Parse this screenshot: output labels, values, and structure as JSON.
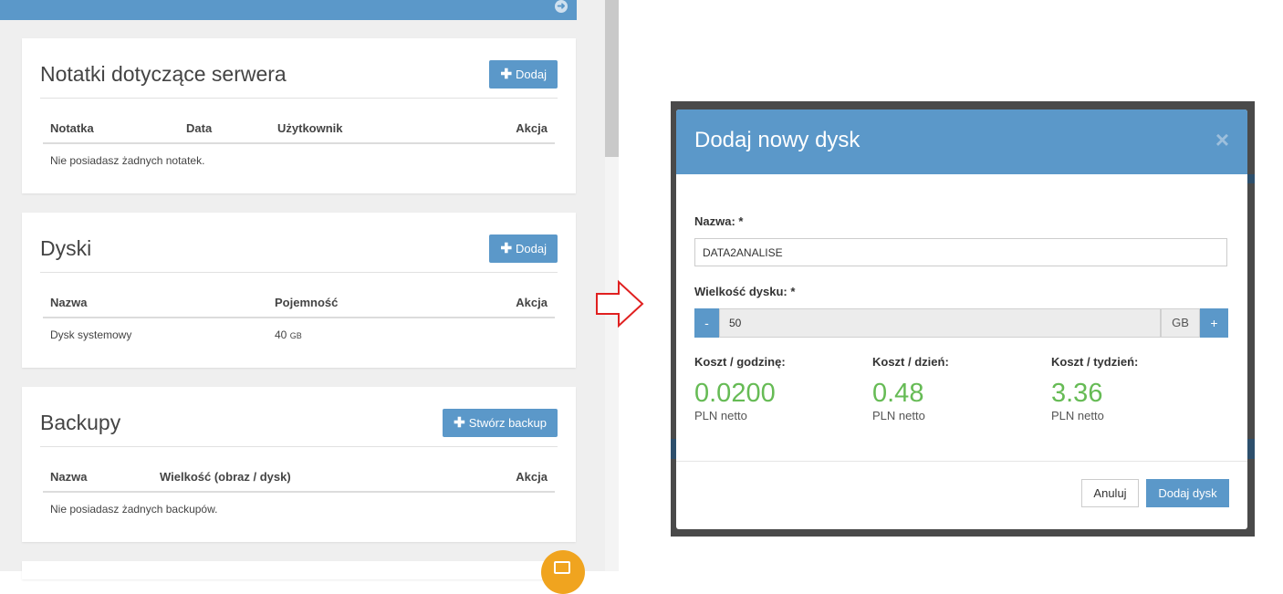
{
  "notes": {
    "title": "Notatki dotyczące serwera",
    "add_label": "Dodaj",
    "columns": [
      "Notatka",
      "Data",
      "Użytkownik",
      "Akcja"
    ],
    "empty": "Nie posiadasz żadnych notatek."
  },
  "disks": {
    "title": "Dyski",
    "add_label": "Dodaj",
    "columns": [
      "Nazwa",
      "Pojemność",
      "Akcja"
    ],
    "rows": [
      {
        "name": "Dysk systemowy",
        "size": "40",
        "unit": "GB"
      }
    ]
  },
  "backups": {
    "title": "Backupy",
    "add_label": "Stwórz backup",
    "columns": [
      "Nazwa",
      "Wielkość (obraz / dysk)",
      "Akcja"
    ],
    "empty": "Nie posiadasz żadnych backupów."
  },
  "modal": {
    "title": "Dodaj nowy dysk",
    "close": "×",
    "name_label": "Nazwa: *",
    "name_value": "DATA2ANALISE",
    "size_label": "Wielkość dysku: *",
    "size_value": "50",
    "size_unit": "GB",
    "minus": "-",
    "plus": "+",
    "costs": [
      {
        "label": "Koszt / godzinę:",
        "value": "0.0200",
        "unit": "PLN netto"
      },
      {
        "label": "Koszt / dzień:",
        "value": "0.48",
        "unit": "PLN netto"
      },
      {
        "label": "Koszt / tydzień:",
        "value": "3.36",
        "unit": "PLN netto"
      }
    ],
    "cancel_label": "Anuluj",
    "submit_label": "Dodaj dysk"
  },
  "colors": {
    "primary": "#5b98c9",
    "cost": "#66bb55",
    "fab": "#f0a41f",
    "arrow": "#e02020"
  }
}
